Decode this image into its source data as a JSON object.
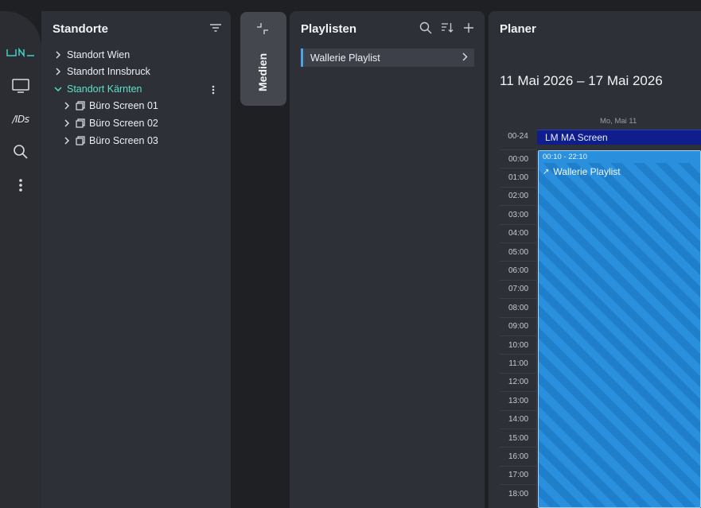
{
  "rail": {
    "items": [
      {
        "name": "brand-logo-icon"
      },
      {
        "name": "monitor-icon"
      },
      {
        "name": "ads-logo-icon",
        "label": "/IDs"
      },
      {
        "name": "search-icon"
      },
      {
        "name": "more-vertical-icon"
      }
    ]
  },
  "standorte": {
    "title": "Standorte",
    "filter_icon": "filter-icon",
    "tree": [
      {
        "label": "Standort Wien",
        "expanded": false,
        "active": false
      },
      {
        "label": "Standort Innsbruck",
        "expanded": false,
        "active": false
      },
      {
        "label": "Standort Kärnten",
        "expanded": true,
        "active": true,
        "children": [
          {
            "label": "Büro Screen 01"
          },
          {
            "label": "Büro Screen 02"
          },
          {
            "label": "Büro Screen 03"
          }
        ]
      }
    ]
  },
  "medien": {
    "label": "Medien",
    "expand_icon": "collapse-arrows-icon"
  },
  "playlisten": {
    "title": "Playlisten",
    "icons": [
      "search-icon",
      "sort-icon",
      "add-icon"
    ],
    "items": [
      {
        "label": "Wallerie Playlist"
      }
    ]
  },
  "planer": {
    "title": "Planer",
    "date_range": "11 Mai 2026 – 17 Mai 2026",
    "day_label": "Mo, Mai 11",
    "allday_label": "00-24",
    "allday_event": "LM MA Screen",
    "hours": [
      "00:00",
      "01:00",
      "02:00",
      "03:00",
      "04:00",
      "05:00",
      "06:00",
      "07:00",
      "08:00",
      "09:00",
      "10:00",
      "11:00",
      "12:00",
      "13:00",
      "14:00",
      "15:00",
      "16:00",
      "17:00",
      "18:00"
    ],
    "event": {
      "time": "00:10 - 22:10",
      "title": "Wallerie Playlist",
      "color": "#2a8fdc"
    }
  },
  "colors": {
    "accent_teal": "#5fe0c8",
    "accent_blue": "#4aa3e6",
    "allday_event_bg": "#0f1e8c"
  }
}
